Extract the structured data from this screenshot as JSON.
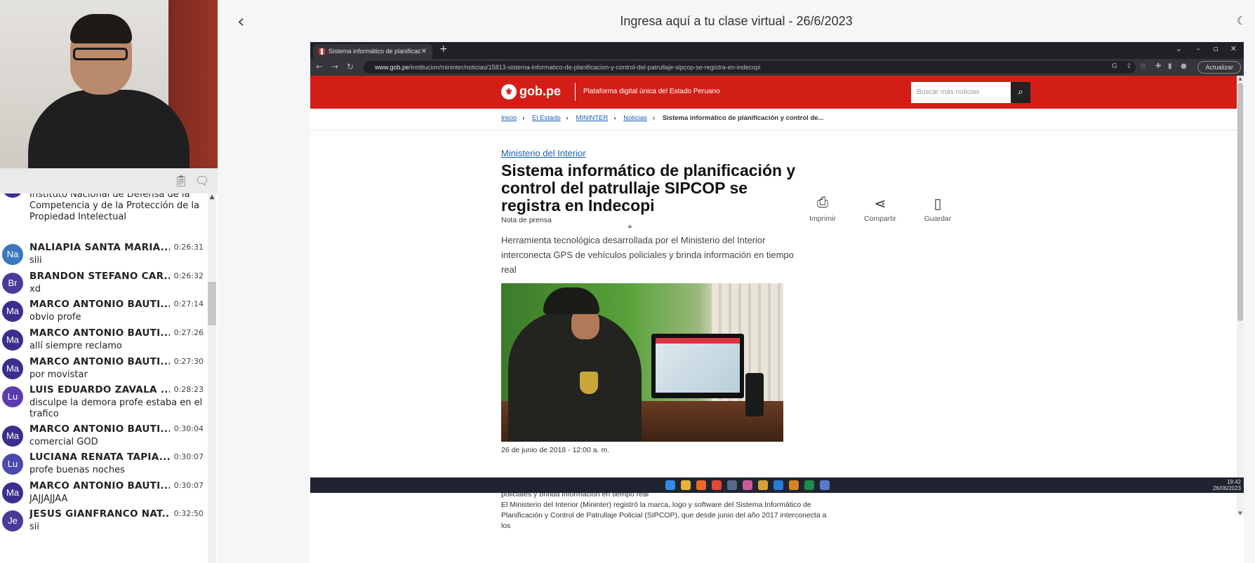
{
  "header": {
    "title": "Ingresa aquí a tu clase virtual - 26/6/2023"
  },
  "chat": {
    "partial_message": "Instituto Nacional de Defensa de la Competencia y de la Protección de la Propiedad Intelectual",
    "messages": [
      {
        "initials": "Na",
        "name": "NALIAPIA SANTA MARIA...",
        "time": "0:26:31",
        "text": "siii",
        "color": "#3b78c2"
      },
      {
        "initials": "Br",
        "name": "BRANDON STEFANO CAR...",
        "time": "0:26:32",
        "text": "xd",
        "color": "#4a3a9a"
      },
      {
        "initials": "Ma",
        "name": "MARCO ANTONIO BAUTI...",
        "time": "0:27:14",
        "text": "obvio profe",
        "color": "#3a2f8e"
      },
      {
        "initials": "Ma",
        "name": "MARCO ANTONIO BAUTI...",
        "time": "0:27:26",
        "text": "allí siempre reclamo",
        "color": "#3a2f8e"
      },
      {
        "initials": "Ma",
        "name": "MARCO ANTONIO BAUTI...",
        "time": "0:27:30",
        "text": "por movistar",
        "color": "#3a2f8e"
      },
      {
        "initials": "Lu",
        "name": "LUIS EDUARDO ZAVALA ...",
        "time": "0:28:23",
        "text": "disculpe la demora profe estaba en el trafico",
        "color": "#5d3ab0"
      },
      {
        "initials": "Ma",
        "name": "MARCO ANTONIO BAUTI...",
        "time": "0:30:04",
        "text": "comercial GOD",
        "color": "#3a2f8e"
      },
      {
        "initials": "Lu",
        "name": "LUCIANA RENATA TAPIA...",
        "time": "0:30:07",
        "text": "profe buenas noches",
        "color": "#4a4ab0"
      },
      {
        "initials": "Ma",
        "name": "MARCO ANTONIO BAUTI...",
        "time": "0:30:07",
        "text": "JAJJAJJAA",
        "color": "#3a2f8e"
      },
      {
        "initials": "Je",
        "name": "JESUS GIANFRANCO NAT...",
        "time": "0:32:50",
        "text": "sii",
        "color": "#4a3a9a"
      }
    ]
  },
  "browser": {
    "tab_title": "Sistema informático de planificac",
    "url_domain": "www.gob.pe",
    "url_path": "/institucion/mininter/noticias/15813-sistema-informatico-de-planificacion-y-control-del-patrullaje-sipcop-se-registra-en-indecopi",
    "update_label": "Actualizar"
  },
  "site": {
    "logo": "gob.pe",
    "tagline": "Plataforma digital única del Estado Peruano",
    "search_placeholder": "Buscar más noticias",
    "breadcrumbs": [
      "Inicio",
      "El Estado",
      "MININTER",
      "Noticias"
    ],
    "breadcrumb_current": "Sistema informático de planificación y control de...",
    "ministry": "Ministerio del Interior",
    "headline": "Sistema informático de planificación y control del patrullaje SIPCOP se registra en Indecopi",
    "type": "Nota de prensa",
    "lead": "Herramienta tecnológica desarrollada por el Ministerio del Interior interconecta  GPS de vehículos policiales y brinda información en tiempo real",
    "date": "26 de junio de 2018 - 12:00 a. m.",
    "body_1": "Herramienta tecnológica desarrollada por el Ministerio del Interior interconecta  GPS de vehículos policiales y brinda información en tiempo real",
    "body_2": "El Ministerio del Interior (Mininter) registró la marca, logo y software del Sistema Informático de Planificación y Control de Patrullaje Policial (SIPCOP), que desde junio del año 2017 interconecta a los",
    "actions": [
      {
        "label": "Imprimir",
        "icon": "printer-icon"
      },
      {
        "label": "Compartir",
        "icon": "share-icon"
      },
      {
        "label": "Guardar",
        "icon": "bookmark-icon"
      }
    ]
  },
  "taskbar": {
    "time": "19:42",
    "date": "26/06/2023"
  }
}
